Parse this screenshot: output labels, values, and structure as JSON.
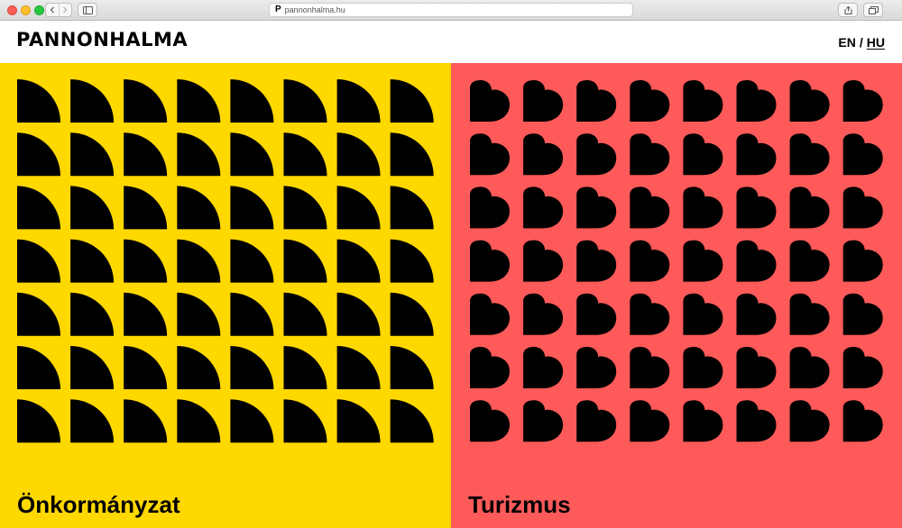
{
  "browser": {
    "url": "pannonhalma.hu",
    "favicon_letter": "P"
  },
  "header": {
    "logo": "PANNONHALMA",
    "lang": {
      "en": "EN",
      "separator": "/",
      "hu": "HU"
    }
  },
  "panels": [
    {
      "title": "Önkormányzat",
      "color": "#ffd800",
      "icon": "quarter-circle-icon"
    },
    {
      "title": "Turizmus",
      "color": "#ff5a5a",
      "icon": "heart-icon"
    }
  ],
  "pattern_color": "#000000"
}
